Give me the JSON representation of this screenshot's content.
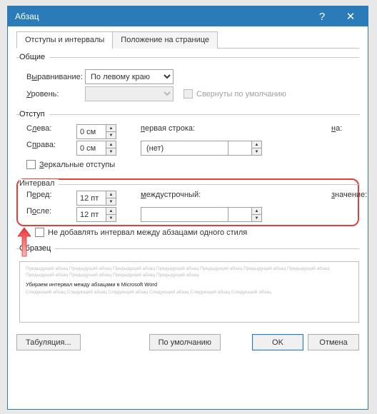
{
  "title": "Абзац",
  "tabs": [
    "Отступы и интервалы",
    "Положение на странице"
  ],
  "general": {
    "legend": "Общие",
    "align_label_pre": "В",
    "align_label_u": "ы",
    "align_label_post": "равнивание:",
    "align_value": "По левому краю",
    "level_label_u": "У",
    "level_label_post": "ровень:",
    "level_value": "",
    "collapse": "Свернуты по умолчанию"
  },
  "indent": {
    "legend": "Отступ",
    "left_label": "Слева:",
    "left_u": "л",
    "left_value": "0 см",
    "right_label": "Справа:",
    "right_u": "п",
    "right_value": "0 см",
    "first_line_label": "первая строка:",
    "first_line_u": "п",
    "first_line_value": "(нет)",
    "on_label": "на:",
    "on_u": "н",
    "on_value": "",
    "mirror": "Зеркальные отступы",
    "mirror_u": "З"
  },
  "spacing": {
    "legend": "Интервал",
    "before_label": "Перед:",
    "before_u": "е",
    "before_value": "12 пт",
    "after_label": "После:",
    "after_u": "о",
    "after_value": "12 пт",
    "line_label": "междустрочный:",
    "line_u": "м",
    "line_value": "",
    "val_label": "значение:",
    "val_u": "з",
    "val_value": "",
    "no_add": "Не добавлять интервал между абзацами одного стиля"
  },
  "preview": {
    "legend": "Образец",
    "grey_prev": "Предыдущий абзац Предыдущий абзац Предыдущий абзац Предыдущий абзац Предыдущий абзац Предыдущий абзац Предыдущий абзац Предыдущий абзац Предыдущий абзац Предыдущий абзац Предыдущий абзац",
    "black": "Убираем интервал между абзацами в Microsoft Word",
    "grey_next": "Следующий абзац Следующий абзац Следующий абзац Следующий абзац Следующий абзац Следующий абзац"
  },
  "buttons": {
    "tabs": "Табуляция...",
    "default": "По умолчанию",
    "ok": "OK",
    "cancel": "Отмена"
  }
}
